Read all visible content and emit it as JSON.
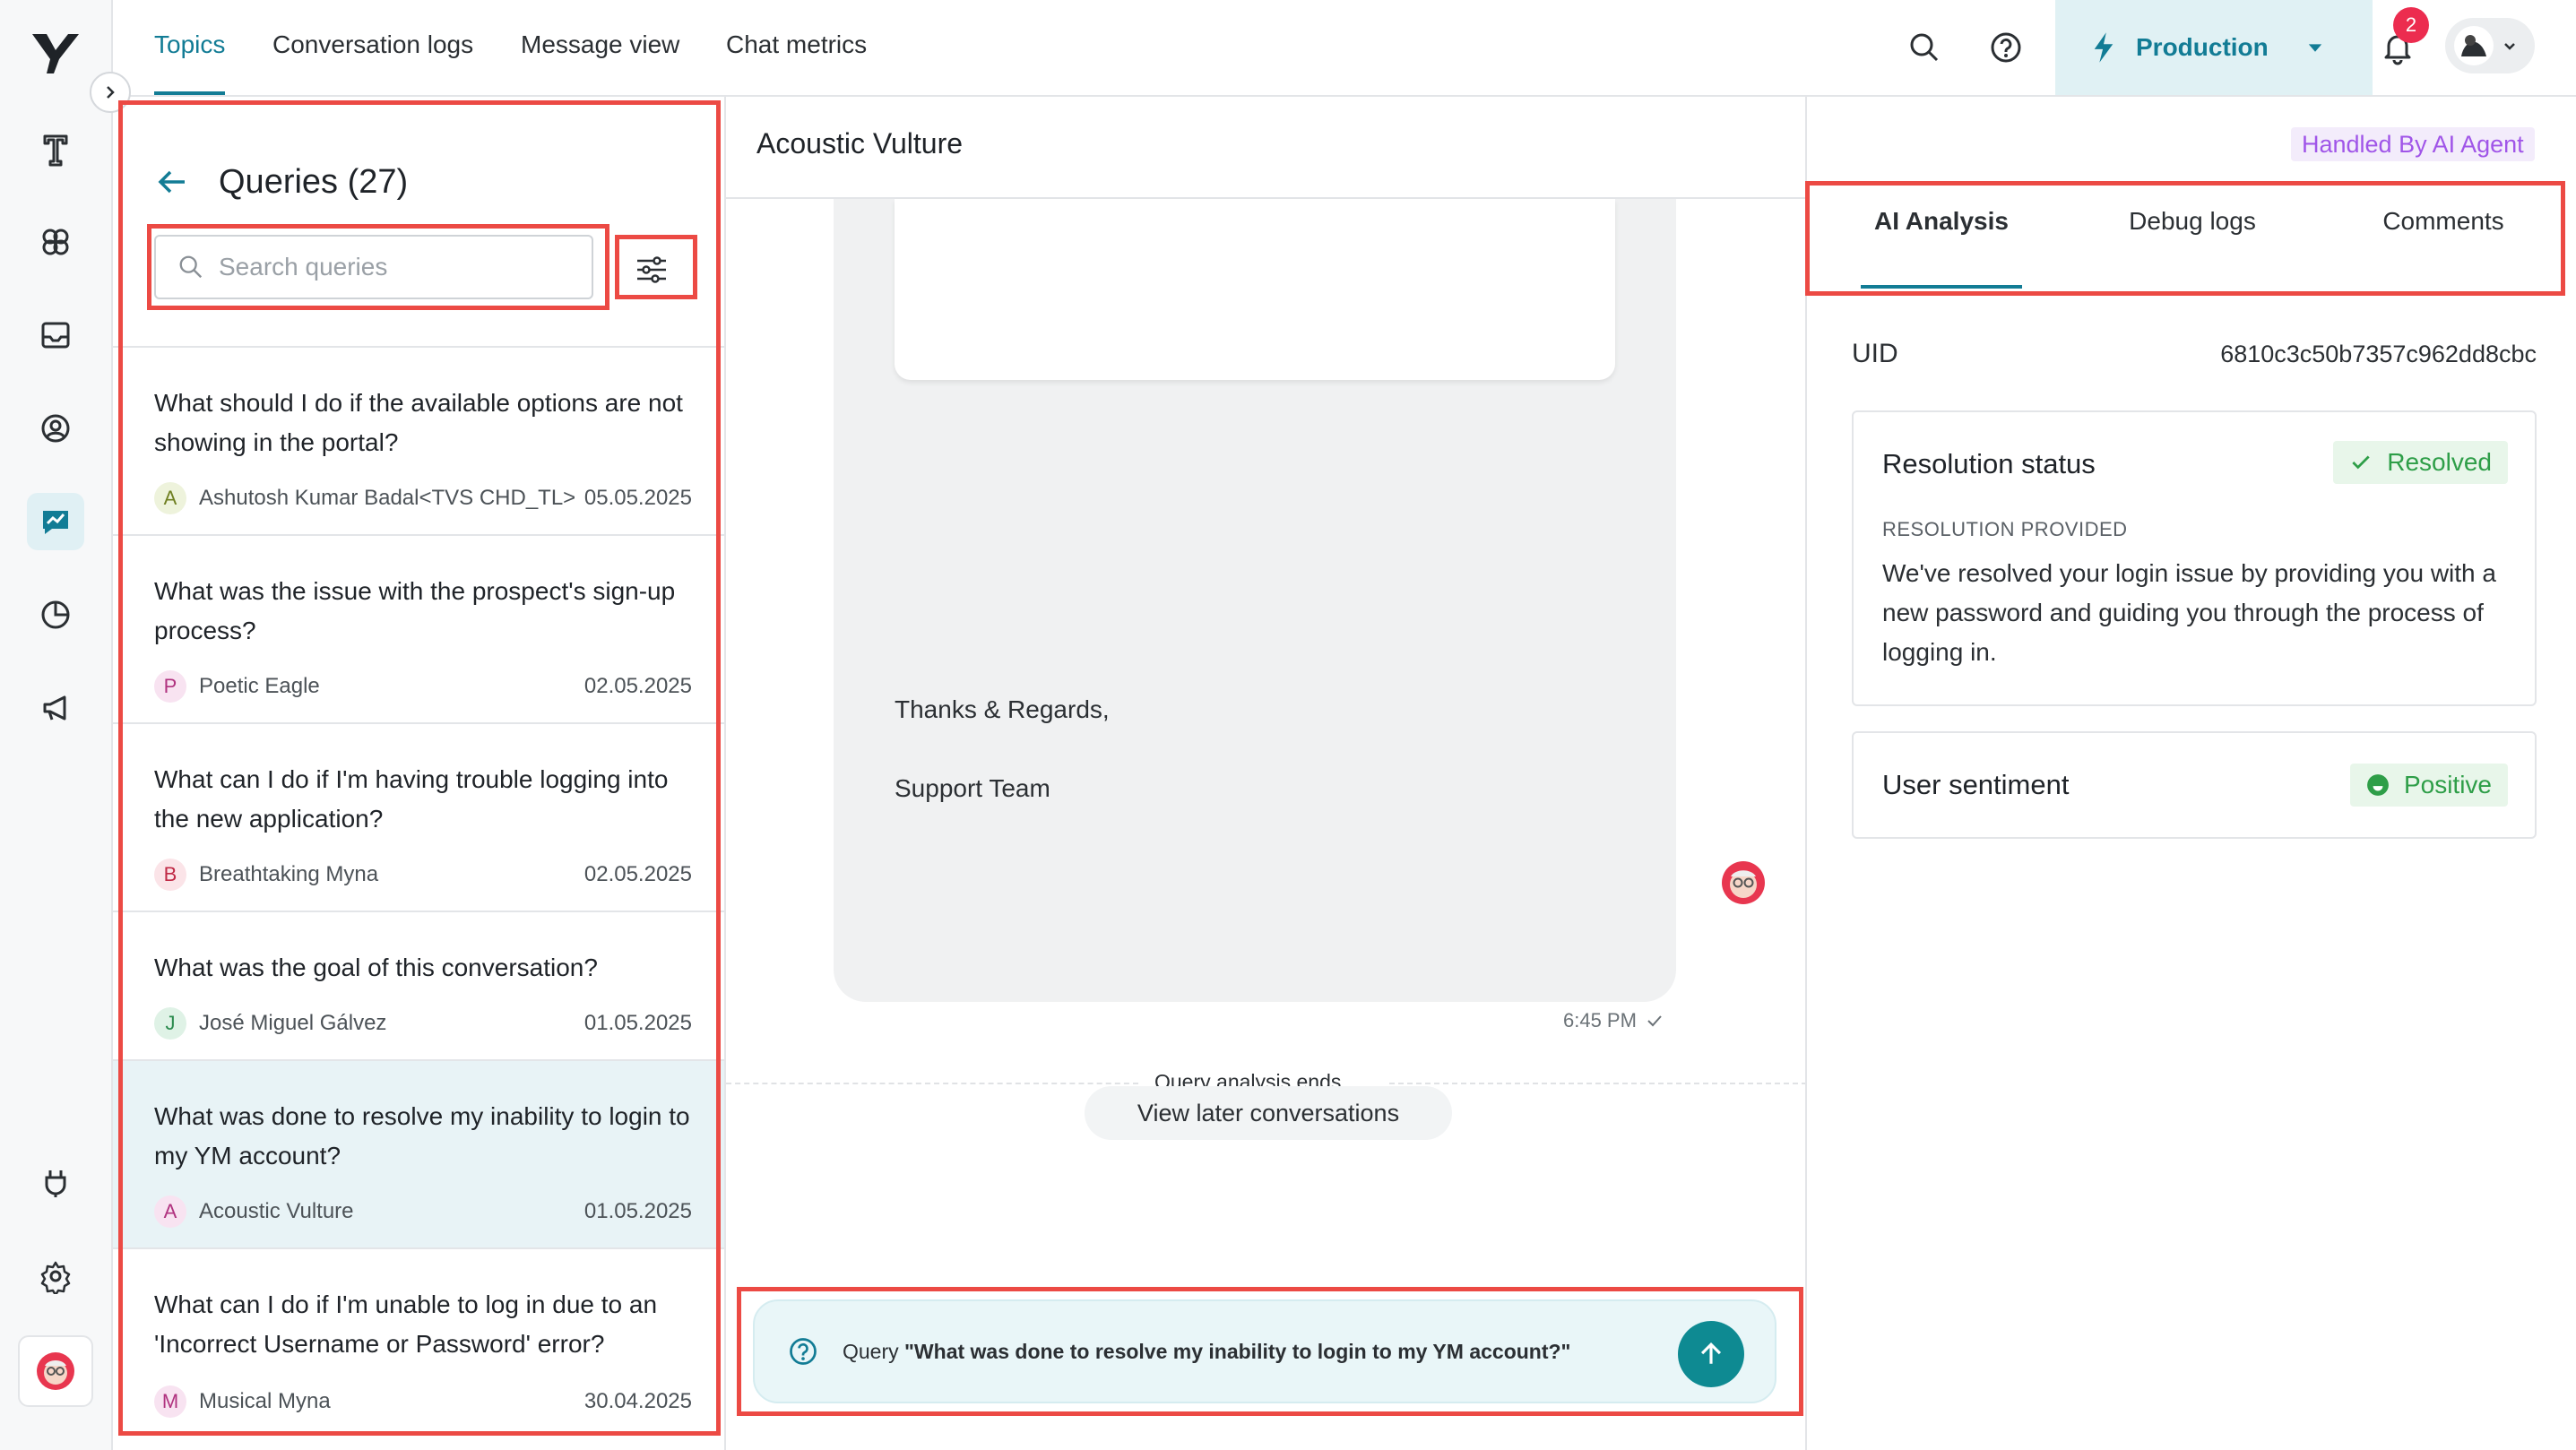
{
  "top_nav": {
    "tabs": [
      {
        "label": "Topics",
        "active": true
      },
      {
        "label": "Conversation logs",
        "active": false
      },
      {
        "label": "Message view",
        "active": false
      },
      {
        "label": "Chat metrics",
        "active": false
      }
    ],
    "environment": "Production",
    "notification_count": "2"
  },
  "queries_panel": {
    "title": "Queries (27)",
    "search_placeholder": "Search queries",
    "items": [
      {
        "question": "What should I do if the available options are not showing in the portal?",
        "initial": "A",
        "user": "Ashutosh Kumar Badal<TVS CHD_TL>",
        "date": "05.05.2025",
        "selected": false
      },
      {
        "question": "What was the issue with the prospect's sign-up process?",
        "initial": "P",
        "user": "Poetic Eagle",
        "date": "02.05.2025",
        "selected": false
      },
      {
        "question": "What can I do if I'm having trouble logging into the new application?",
        "initial": "B",
        "user": "Breathtaking Myna",
        "date": "02.05.2025",
        "selected": false
      },
      {
        "question": "What was the goal of this conversation?",
        "initial": "J",
        "user": "José Miguel Gálvez",
        "date": "01.05.2025",
        "selected": false
      },
      {
        "question": "What was done to resolve my inability to login to my YM account?",
        "initial": "A",
        "user": "Acoustic Vulture",
        "date": "01.05.2025",
        "selected": true
      },
      {
        "question": "What can I do if I'm unable to log in due to an 'Incorrect Username or Password' error?",
        "initial": "M",
        "user": "Musical Myna",
        "date": "30.04.2025",
        "selected": false
      }
    ]
  },
  "conversation": {
    "title": "Acoustic Vulture",
    "message_lines": [
      "Thanks & Regards,",
      "Support Team"
    ],
    "time": "6:45 PM",
    "analysis_end": "Query analysis ends",
    "view_later": "View later conversations",
    "query_prefix": "Query",
    "query_text": "\"What was done to resolve my inability to login to my YM account?\""
  },
  "analysis_panel": {
    "handled_badge": "Handled By AI Agent",
    "tabs": [
      {
        "label": "AI Analysis",
        "active": true
      },
      {
        "label": "Debug logs",
        "active": false
      },
      {
        "label": "Comments",
        "active": false
      }
    ],
    "uid_label": "UID",
    "uid_value": "6810c3c50b7357c962dd8cbc",
    "resolution": {
      "title": "Resolution status",
      "status": "Resolved",
      "provided_label": "RESOLUTION PROVIDED",
      "provided_text": "We've resolved your login issue by providing you with a new password and guiding you through the process of logging in."
    },
    "sentiment": {
      "title": "User sentiment",
      "value": "Positive"
    }
  },
  "colors": {
    "accent": "#127c95",
    "highlight_box": "#ec4a44",
    "resolved_bg": "#e8f6ea",
    "resolved_fg": "#2e9e48",
    "handled_fg": "#a055e8"
  }
}
